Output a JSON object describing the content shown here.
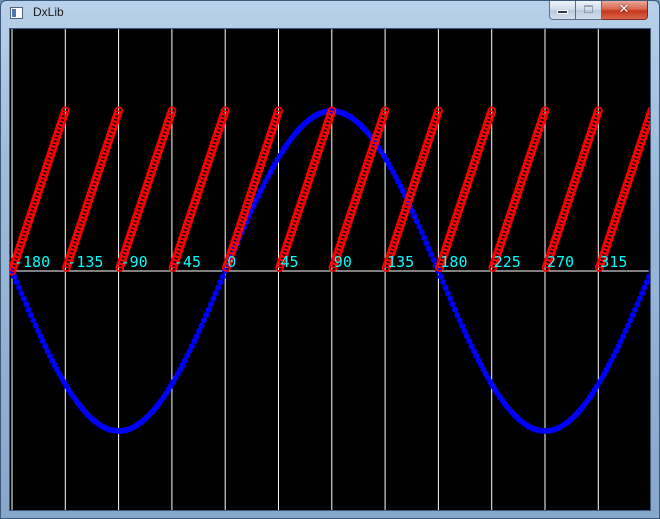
{
  "window": {
    "title": "DxLib",
    "close_glyph": "✕"
  },
  "icons": {
    "app": "app-window-icon",
    "minimize": "minimize-icon",
    "maximize": "maximize-icon",
    "close": "close-icon"
  },
  "chart_data": {
    "type": "scatter",
    "x": [
      -180,
      -135,
      -90,
      -45,
      0,
      45,
      90,
      135,
      180,
      225,
      270,
      315
    ],
    "x_tick_labels": [
      "-180",
      "-135",
      "-90",
      "-45",
      "0",
      "45",
      "90",
      "135",
      "180",
      "225",
      "270",
      "315"
    ],
    "xlim": [
      -180,
      360
    ],
    "ylim": [
      -1,
      1
    ],
    "grid": true,
    "series": [
      {
        "color": "#0000ff",
        "marker": "filled-circle",
        "x_step_deg": 2,
        "shape": "sine"
      },
      {
        "color": "#ff0000",
        "marker": "hollow-circle",
        "x_step_deg": 1,
        "shape": "sawtooth",
        "period_deg": 45,
        "range": [
          0,
          1
        ]
      }
    ],
    "colors": {
      "background": "#000000",
      "grid": "#ffffff",
      "axis": "#ffffff",
      "tick_label": "#00ffff"
    }
  }
}
